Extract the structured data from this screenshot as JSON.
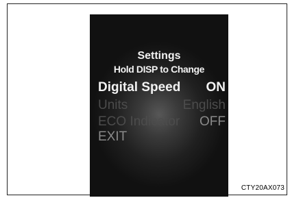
{
  "display": {
    "title": "Settings",
    "subtitle": "Hold DISP to Change",
    "menu": [
      {
        "label": "Digital Speed",
        "value": "ON"
      },
      {
        "label": "Units",
        "value": "English"
      },
      {
        "label": "ECO Indicator",
        "value": "OFF"
      },
      {
        "label": "EXIT",
        "value": ""
      }
    ]
  },
  "caption": "CTY20AX073",
  "colors": {
    "selected_text": "#f2f2f2",
    "dim_text": "#4c4c4c",
    "background": "#1a1a1a"
  }
}
